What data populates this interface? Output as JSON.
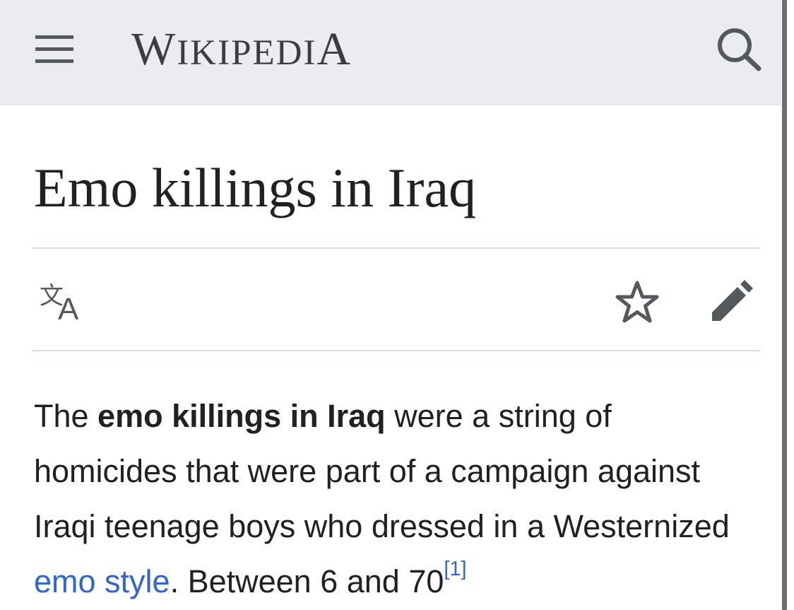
{
  "header": {
    "menu_icon": "hamburger-menu-icon",
    "logo": {
      "first_big": "W",
      "middle_small": "IKIPEDI",
      "last_big": "A"
    },
    "search_icon": "search-icon"
  },
  "article": {
    "title": "Emo killings in Iraq",
    "actions": {
      "language_icon": "language-translate-icon",
      "watch_icon": "star-icon",
      "edit_icon": "pencil-edit-icon"
    },
    "lead": {
      "p1": "The ",
      "bold": "emo killings in Iraq",
      "p2": " were a string of homicides that were part of a campaign against Iraqi teenage boys who dressed in a Westernized ",
      "link": "emo style",
      "p3": ". Between 6 and 70",
      "ref": "[1]"
    }
  },
  "colors": {
    "header_bg": "#eaecf0",
    "text": "#202122",
    "link": "#3366cc",
    "icon": "#54595d"
  }
}
